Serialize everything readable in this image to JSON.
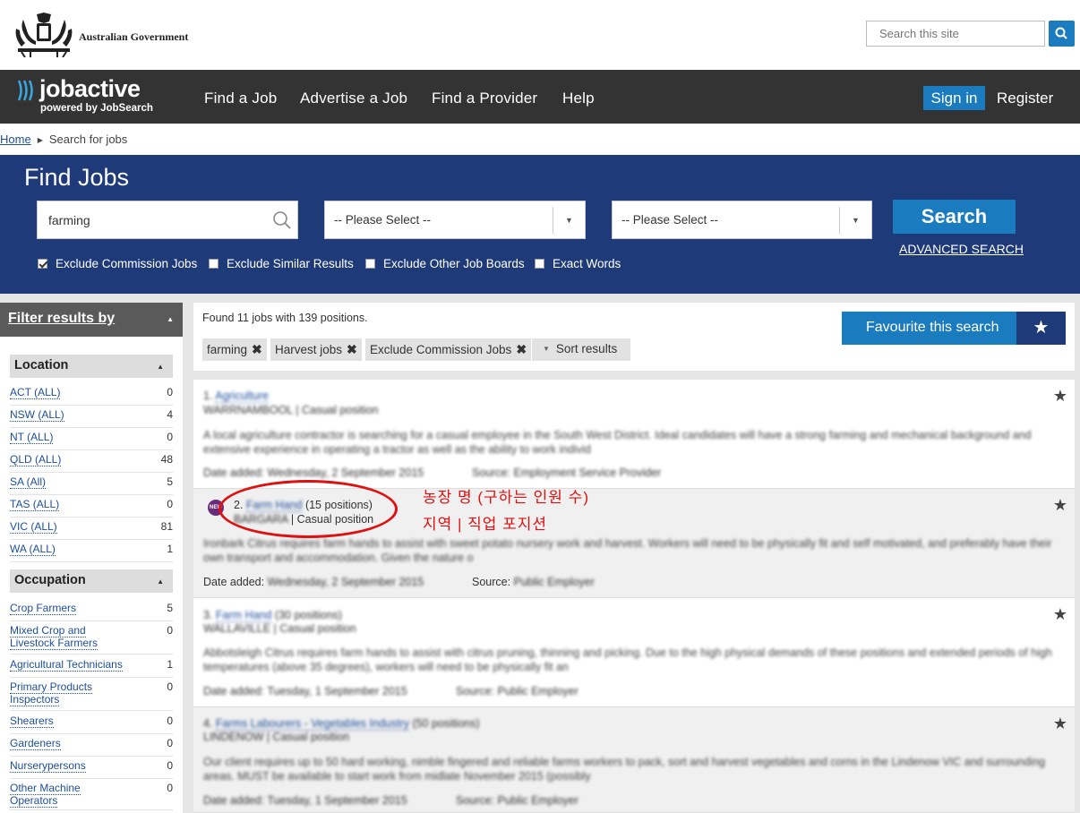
{
  "gov": {
    "name": "Australian Government",
    "search_placeholder": "Search this site"
  },
  "nav": {
    "logo_word": "jobactive",
    "logo_sub": "powered by JobSearch",
    "items": [
      "Find a Job",
      "Advertise a Job",
      "Find a Provider",
      "Help"
    ],
    "signin": "Sign in",
    "register": "Register"
  },
  "breadcrumb": {
    "home": "Home",
    "current": "Search for jobs"
  },
  "find": {
    "title": "Find Jobs",
    "keyword": "farming",
    "select1": "-- Please Select --",
    "select2": "-- Please Select --",
    "search_label": "Search",
    "advanced": "ADVANCED SEARCH",
    "checks": [
      {
        "label": "Exclude Commission Jobs",
        "checked": true
      },
      {
        "label": "Exclude Similar Results",
        "checked": false
      },
      {
        "label": "Exclude Other Job Boards",
        "checked": false
      },
      {
        "label": "Exact Words",
        "checked": false
      }
    ]
  },
  "filter": {
    "title": "Filter results by",
    "location": {
      "title": "Location",
      "items": [
        {
          "label": "ACT (ALL)",
          "count": "0"
        },
        {
          "label": "NSW (ALL)",
          "count": "4"
        },
        {
          "label": "NT (ALL)",
          "count": "0"
        },
        {
          "label": "QLD (ALL)",
          "count": "48"
        },
        {
          "label": "SA (All)",
          "count": "5"
        },
        {
          "label": "TAS (ALL)",
          "count": "0"
        },
        {
          "label": "VIC (ALL)",
          "count": "81"
        },
        {
          "label": "WA (ALL)",
          "count": "1"
        }
      ]
    },
    "occupation": {
      "title": "Occupation",
      "items": [
        {
          "label": "Crop Farmers",
          "count": "5"
        },
        {
          "label": "Mixed Crop and Livestock Farmers",
          "count": "0"
        },
        {
          "label": "Agricultural Technicians",
          "count": "1"
        },
        {
          "label": "Primary Products Inspectors",
          "count": "0"
        },
        {
          "label": "Shearers",
          "count": "0"
        },
        {
          "label": "Gardeners",
          "count": "0"
        },
        {
          "label": "Nurserypersons",
          "count": "0"
        },
        {
          "label": "Other Machine Operators",
          "count": "0"
        }
      ]
    }
  },
  "results_header": {
    "found": "Found 11 jobs with 139 positions.",
    "tags": [
      "farming",
      "Harvest jobs",
      "Exclude Commission Jobs"
    ],
    "sort": "Sort results",
    "favourite": "Favourite this search"
  },
  "jobs": [
    {
      "num": "1.",
      "title": "Agriculture",
      "positions": "",
      "location": "WARRNAMBOOL | Casual position",
      "desc": "A local agriculture contractor is searching for a casual employee in the South West District. Ideal candidates will have a strong farming and mechanical background and extensive experience in operating a tractor as well as the ability to work individ",
      "date": "Date added: Wednesday, 2 September 2015",
      "source": "Source: Employment Service Provider"
    },
    {
      "num": "2.",
      "title": "Farm Hand",
      "positions": "(15 positions)",
      "location_place": "BARGARA",
      "location_type": "| Casual position",
      "badge": "NEW",
      "desc": "Ironbark Citrus requires farm hands to assist with sweet potato nursery work and harvest. Workers will need to be physically fit and self motivated, and preferably have their own transport and accommodation.  Given the nature o",
      "date_label": "Date added:",
      "date_value": "Wednesday, 2 September 2015",
      "source_label": "Source:",
      "source_value": "Public Employer"
    },
    {
      "num": "3.",
      "title": "Farm Hand",
      "positions": "(30 positions)",
      "location": "WALLAVILLE | Casual position",
      "desc": "Abbotsleigh Citrus requires farm hands to assist with citrus pruning, thinning and picking. Due to the high physical demands of these positions and extended periods of high temperatures (above 35 degrees), workers will need to be physically fit an",
      "date": "Date added: Tuesday, 1 September 2015",
      "source": "Source: Public Employer"
    },
    {
      "num": "4.",
      "title": "Farms Labourers - Vegetables Industry",
      "positions": "(50 positions)",
      "location": "LINDENOW | Casual position",
      "desc": "Our client requires up to 50 hard working, nimble fingered and reliable farms workers to pack, sort and harvest vegetables and corns in the Lindenow VIC and surrounding areas. MUST be available to start work from midlate November 2015 (possibly",
      "date": "Date added: Tuesday, 1 September 2015",
      "source": "Source: Public Employer"
    }
  ],
  "annotation": {
    "line1": "농장 명 (구하는 인원 수)",
    "line2": "지역  |  직업 포지션",
    "color": "#e01010"
  }
}
